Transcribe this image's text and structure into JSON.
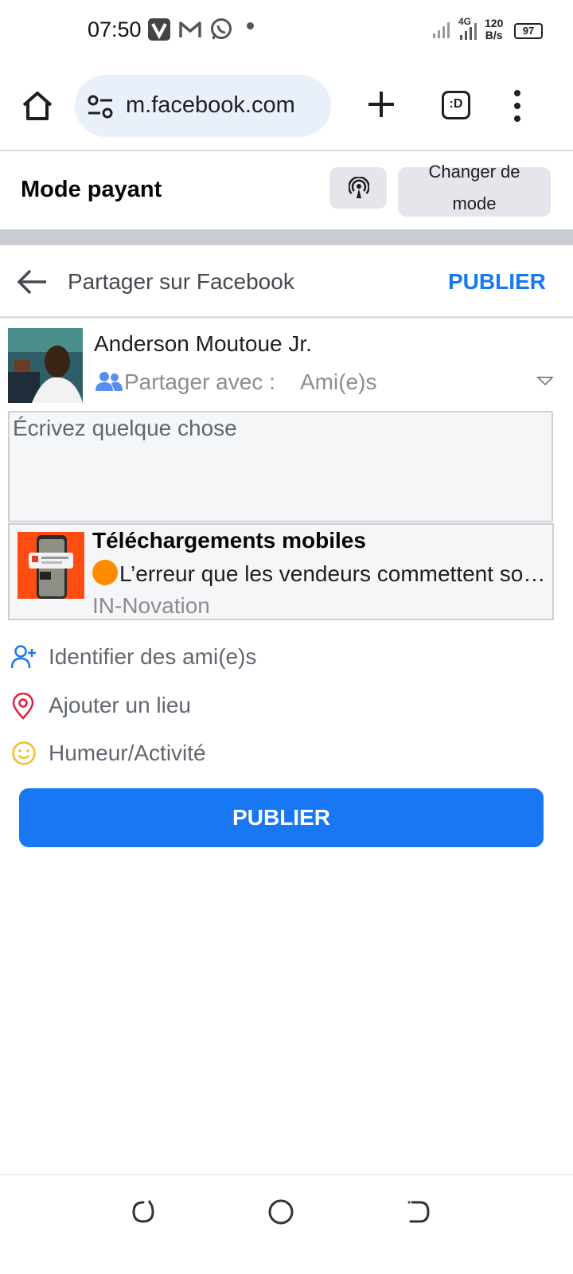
{
  "status_bar": {
    "time": "07:50",
    "network": "4G",
    "speed_value": "120",
    "speed_unit": "B/s",
    "battery": "97"
  },
  "browser": {
    "url": "m.facebook.com",
    "tab_label": ":D"
  },
  "mode_bar": {
    "title": "Mode payant",
    "switch_label": "Changer de mode"
  },
  "composer": {
    "title": "Partager sur Facebook",
    "publish_link": "PUBLIER",
    "user_name": "Anderson Moutoue Jr.",
    "privacy_label": "Partager avec :",
    "privacy_value": "Ami(e)s",
    "placeholder": "Écrivez quelque chose",
    "link_card": {
      "title": "Téléchargements mobiles",
      "description": "L’erreur que les vendeurs commettent souvent",
      "source": "IN-Novation"
    },
    "options": [
      {
        "label": "Identifier des ami(e)s"
      },
      {
        "label": "Ajouter un lieu"
      },
      {
        "label": "Humeur/Activité"
      }
    ],
    "publish_button": "PUBLIER"
  },
  "colors": {
    "accent": "#1877f2",
    "tag_icon": "#1877f2",
    "location_icon": "#e41e3f",
    "mood_icon": "#f7b928"
  }
}
